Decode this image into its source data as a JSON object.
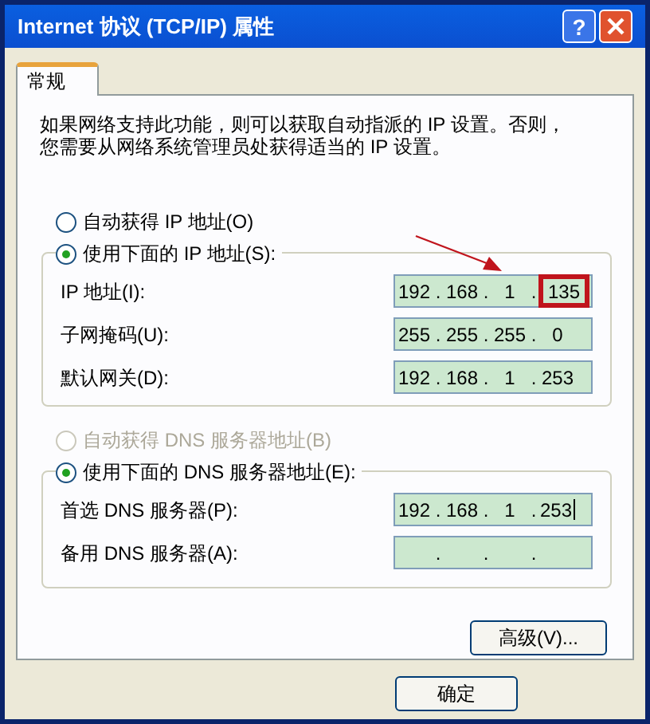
{
  "window": {
    "title": "Internet 协议 (TCP/IP) 属性",
    "help_button": "?"
  },
  "tabs": [
    {
      "label": "常规",
      "selected": true
    }
  ],
  "description": "如果网络支持此功能，则可以获取自动指派的 IP 设置。否则，您需要从网络系统管理员处获得适当的 IP 设置。",
  "sections": [
    {
      "auto_option": {
        "label": "自动获得 IP 地址(O)",
        "selected": false,
        "disabled": false
      },
      "manual_option": {
        "label": "使用下面的 IP 地址(S):",
        "selected": true
      },
      "fields": [
        {
          "label": "IP 地址(I):",
          "separator": ".",
          "arrow": true,
          "octets": [
            {
              "text": "192",
              "highlighted": false
            },
            {
              "text": "168",
              "highlighted": false
            },
            {
              "text": "1",
              "highlighted": false
            },
            {
              "text": "135",
              "highlighted": true
            }
          ]
        },
        {
          "label": "子网掩码(U):",
          "separator": ".",
          "octets": [
            {
              "text": "255",
              "highlighted": false
            },
            {
              "text": "255",
              "highlighted": false
            },
            {
              "text": "255",
              "highlighted": false
            },
            {
              "text": "0",
              "highlighted": false
            }
          ]
        },
        {
          "label": "默认网关(D):",
          "separator": ".",
          "octets": [
            {
              "text": "192",
              "highlighted": false
            },
            {
              "text": "168",
              "highlighted": false
            },
            {
              "text": "1",
              "highlighted": false
            },
            {
              "text": "253",
              "highlighted": false
            }
          ]
        }
      ]
    },
    {
      "auto_option": {
        "label": "自动获得 DNS 服务器地址(B)",
        "selected": false,
        "disabled": true
      },
      "manual_option": {
        "label": "使用下面的 DNS 服务器地址(E):",
        "selected": true
      },
      "fields": [
        {
          "label": "首选 DNS 服务器(P):",
          "separator": ".",
          "cursor": true,
          "octets": [
            {
              "text": "192",
              "highlighted": false
            },
            {
              "text": "168",
              "highlighted": false
            },
            {
              "text": "1",
              "highlighted": false
            },
            {
              "text": "253",
              "highlighted": false
            }
          ]
        },
        {
          "label": "备用 DNS 服务器(A):",
          "separator": "."
        }
      ]
    }
  ],
  "advanced_button": "高级(V)...",
  "buttons": [
    "确定"
  ]
}
